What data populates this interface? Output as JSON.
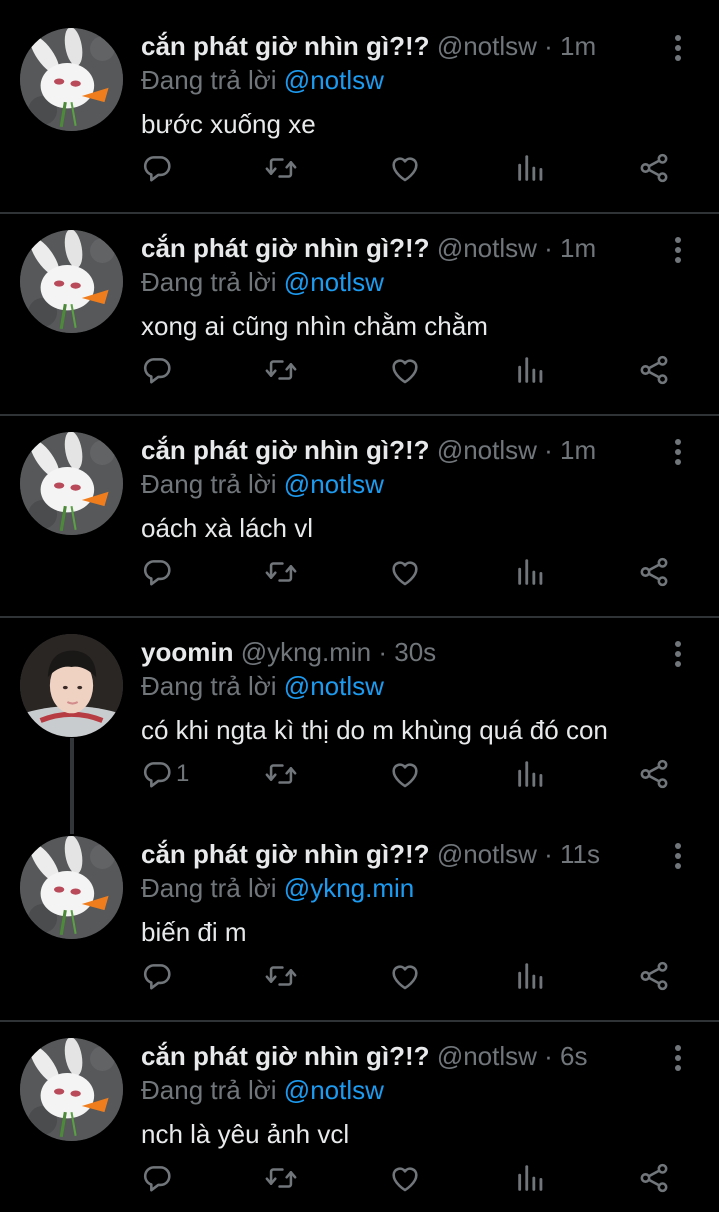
{
  "tweets": [
    {
      "name": "cắn phát giờ nhìn gì?!?",
      "handle": "@notlsw",
      "time": "1m",
      "replying_prefix": "Đang trả lời",
      "replying_to": "@notlsw",
      "text": "bước xuống xe",
      "reply_count": ""
    },
    {
      "name": "cắn phát giờ nhìn gì?!?",
      "handle": "@notlsw",
      "time": "1m",
      "replying_prefix": "Đang trả lời",
      "replying_to": "@notlsw",
      "text": "xong ai cũng nhìn chằm chằm",
      "reply_count": ""
    },
    {
      "name": "cắn phát giờ nhìn gì?!?",
      "handle": "@notlsw",
      "time": "1m",
      "replying_prefix": "Đang trả lời",
      "replying_to": "@notlsw",
      "text": "oách xà lách vl",
      "reply_count": ""
    },
    {
      "name": "yoomin",
      "handle": "@ykng.min",
      "time": "30s",
      "replying_prefix": "Đang trả lời",
      "replying_to": "@notlsw",
      "text": "có khi ngta kì thị do m khùng quá đó con",
      "reply_count": "1"
    },
    {
      "name": "cắn phát giờ nhìn gì?!?",
      "handle": "@notlsw",
      "time": "11s",
      "replying_prefix": "Đang trả lời",
      "replying_to": "@ykng.min",
      "text": "biến đi m",
      "reply_count": ""
    },
    {
      "name": "cắn phát giờ nhìn gì?!?",
      "handle": "@notlsw",
      "time": "6s",
      "replying_prefix": "Đang trả lời",
      "replying_to": "@notlsw",
      "text": "nch là yêu ảnh vcl",
      "reply_count": ""
    }
  ],
  "separator": " · ",
  "icons": {
    "reply": "reply-icon",
    "retweet": "retweet-icon",
    "like": "heart-icon",
    "stats": "stats-icon",
    "share": "share-icon",
    "more": "more-vertical-icon"
  },
  "colors": {
    "background": "#000000",
    "text": "#e7e9ea",
    "muted": "#71767b",
    "link": "#1d9bf0",
    "divider": "#2f3336"
  }
}
